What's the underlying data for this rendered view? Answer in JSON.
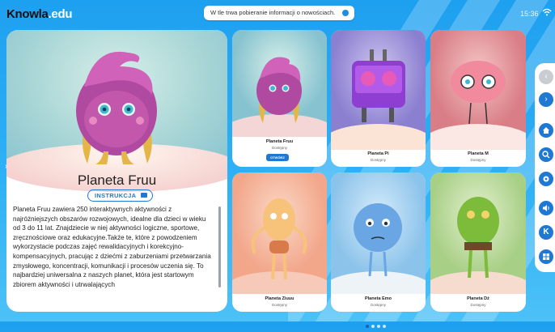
{
  "app": {
    "logo_main": "Knowla",
    "logo_dot": ".",
    "logo_edu": "edu"
  },
  "notice": {
    "text": "W tle trwa pobieranie informacji o nowościach."
  },
  "status_bar": {
    "time": "15:36"
  },
  "featured": {
    "title": "Planeta Fruu",
    "instruction_label": "INSTRUKCJA",
    "description": "Planeta Fruu zawiera 250 interaktywnych aktywności z najróżniejszych obszarów rozwojowych, idealne dla dzieci w wieku od 3 do 11 lat. Znajdziecie w niej aktywności logiczne, sportowe, zręcznościowe oraz edukacyjne.Także te, które z powodzeniem wykorzystacie podczas zajęć rewalidacyjnych i korekcyjno-kompensacyjnych, pracując z dziećmi z zaburzeniami przetwarzania zmysłowego, koncentracji, komunikacji i procesów uczenia się. To najbardziej uniwersalna z naszych planet, która jest startowym zbiorem aktywności i utrwalających"
  },
  "cards": [
    {
      "name": "Planeta Fruu",
      "status": "Dostępny",
      "button": "OTWÓRZ"
    },
    {
      "name": "Planeta Pi",
      "status": "Dostępny"
    },
    {
      "name": "Planeta M",
      "status": "Dostępny"
    },
    {
      "name": "Planeta Ziuuu",
      "status": "Dostępny"
    },
    {
      "name": "Planeta Emo",
      "status": "Dostępny"
    },
    {
      "name": "Planeta Dż",
      "status": "Dostępny"
    }
  ],
  "sidebar": {
    "buttons": [
      "back-icon",
      "forward-icon",
      "home-icon",
      "search-icon",
      "gear-icon",
      "volume-icon",
      "knowla-k-icon",
      "windows-icon"
    ]
  },
  "pagination": {
    "pages": 4,
    "current": 1
  },
  "colors": {
    "accent": "#1f78d1",
    "background": "#2eb1f5"
  }
}
